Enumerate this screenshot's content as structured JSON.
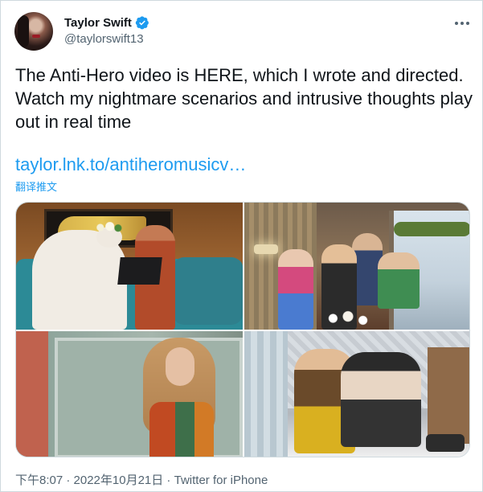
{
  "author": {
    "display_name": "Taylor Swift",
    "handle": "@taylorswift13",
    "verified_icon": "verified-badge-icon",
    "verified_color": "#1d9bf0"
  },
  "more_menu_icon": "more-dots-icon",
  "tweet": {
    "text": "The Anti-Hero video is HERE, which I wrote and directed. Watch my nightmare scenarios and intrusive thoughts play out in real time",
    "link": "taylor.lnk.to/antiheromusicv…",
    "translate_label": "翻译推文"
  },
  "media": {
    "count": 4
  },
  "meta": {
    "timestamp": "下午8:07 · 2022年10月21日",
    "separator": " · ",
    "source": "Twitter for iPhone"
  },
  "colors": {
    "link": "#1d9bf0",
    "secondary_text": "#536471",
    "primary_text": "#0f1419",
    "border": "#cfd9de"
  }
}
